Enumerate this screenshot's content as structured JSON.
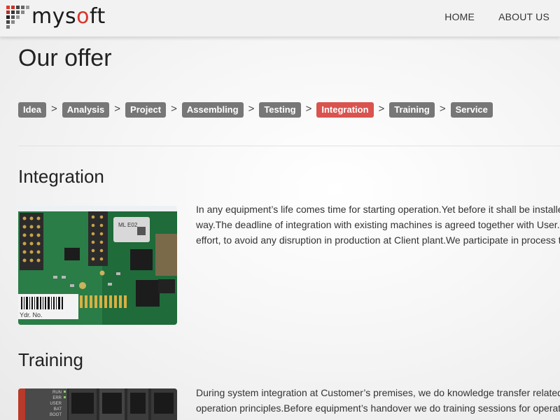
{
  "brand": {
    "name_part1": "mys",
    "name_accent": "o",
    "name_part2": "ft",
    "accent_color": "#d9342b"
  },
  "nav": {
    "items": [
      "HOME",
      "ABOUT US"
    ]
  },
  "page": {
    "title": "Our offer"
  },
  "process": {
    "steps": [
      "Idea",
      "Analysis",
      "Project",
      "Assembling",
      "Testing",
      "Integration",
      "Training",
      "Service"
    ],
    "separator": ">",
    "active_step": "Integration",
    "active_color": "#d9534f",
    "inactive_color": "#777777"
  },
  "sections": [
    {
      "title": "Integration",
      "image_label": "circuit-board-photo",
      "image_text": {
        "chip": "ML E02",
        "sticker": "Ydr. No."
      },
      "lines": [
        "In any equipment’s life comes time for starting operation.Yet before it shall be installe",
        "way.The deadline of integration with existing machines is agreed together with User.I",
        "effort, to avoid any disruption in production at Client plant.We participate in process t"
      ]
    },
    {
      "title": "Training",
      "image_label": "plc-module-photo",
      "image_text": {
        "leds": [
          "RUN",
          "ERR",
          "USER",
          "BAT",
          "BOOT"
        ]
      },
      "lines": [
        "During system integration at Customer’s premises, we do knowledge transfer related",
        "operation principles.Before equipment’s handover we do training sessions for operato"
      ]
    }
  ]
}
